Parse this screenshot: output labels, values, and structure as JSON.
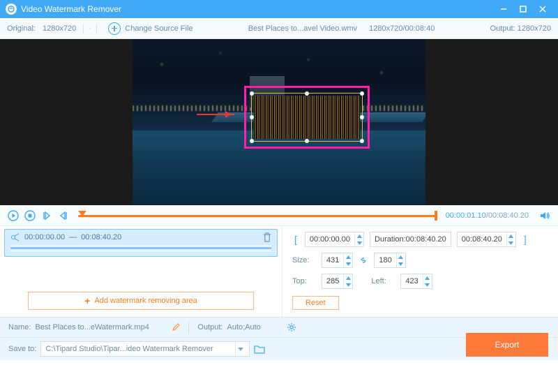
{
  "titlebar": {
    "title": "Video Watermark Remover"
  },
  "infobar": {
    "original_label": "Original:",
    "original_dim": "1280x720",
    "change_source": "Change Source File",
    "filename": "Best Places to...avel Video.wmv",
    "file_dim_time": "1280x720/00:08:40",
    "output_label": "Output:",
    "output_dim": "1280x720"
  },
  "playback": {
    "current": "00:00:01.10",
    "total": "00:08:40.20"
  },
  "segment": {
    "start": "00:00:00.00",
    "sep": "—",
    "end": "00:08:40.20"
  },
  "add_area": "Add watermark removing area",
  "controls": {
    "start": "00:00:00.00",
    "duration_label": "Duration:",
    "duration": "00:08:40.20",
    "end": "00:08:40.20",
    "size_label": "Size:",
    "width": "431",
    "height": "180",
    "top_label": "Top:",
    "top": "285",
    "left_label": "Left:",
    "left": "423",
    "reset": "Reset"
  },
  "footer": {
    "name_label": "Name:",
    "name_value": "Best Places to...eWatermark.mp4",
    "output_label": "Output:",
    "output_value": "Auto;Auto",
    "saveto_label": "Save to:",
    "saveto_value": "C:\\Tipard Studio\\Tipar...ideo Watermark Remover",
    "export": "Export"
  }
}
